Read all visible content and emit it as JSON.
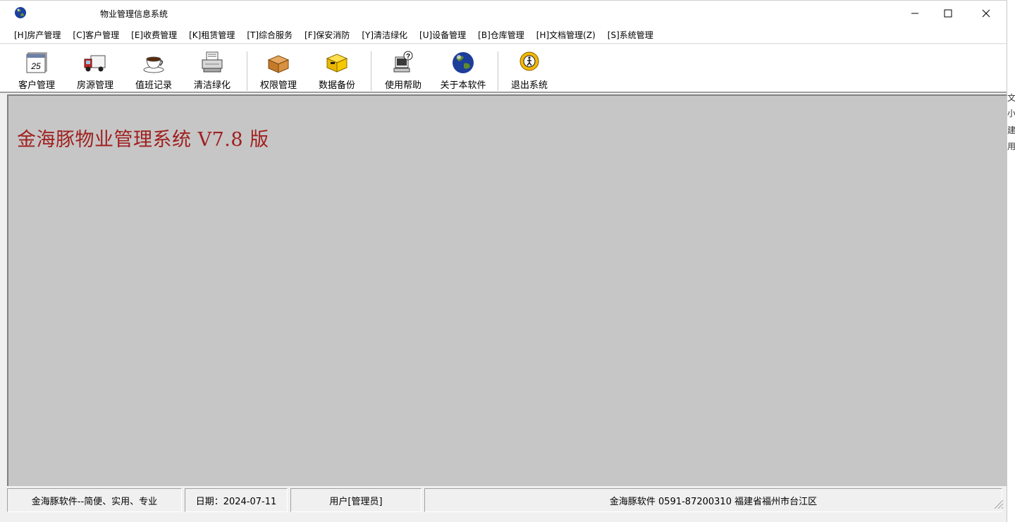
{
  "window": {
    "title": "物业管理信息系统",
    "controls": {
      "minimize": "—",
      "maximize": "☐",
      "close": "✕"
    }
  },
  "menu": [
    "[H]房产管理",
    "[C]客户管理",
    "[E]收费管理",
    "[K]租赁管理",
    "[T]综合服务",
    "[F]保安消防",
    "[Y]清洁绿化",
    "[U]设备管理",
    "[B]仓库管理",
    "[H]文档管理(Z)",
    "[S]系统管理"
  ],
  "toolbar": {
    "customer": {
      "label": "客户管理",
      "icon": "calendar-icon",
      "badge": "25"
    },
    "housing": {
      "label": "房源管理",
      "icon": "truck-icon"
    },
    "duty": {
      "label": "值班记录",
      "icon": "coffee-cup-icon"
    },
    "cleaning": {
      "label": "清洁绿化",
      "icon": "printer-icon"
    },
    "permission": {
      "label": "权限管理",
      "icon": "box-icon"
    },
    "backup": {
      "label": "数据备份",
      "icon": "yellow-box-icon"
    },
    "help": {
      "label": "使用帮助",
      "icon": "help-computer-icon"
    },
    "about": {
      "label": "关于本软件",
      "icon": "globe-icon"
    },
    "exit": {
      "label": "退出系统",
      "icon": "exit-person-icon"
    }
  },
  "main": {
    "title": "金海豚物业管理系统 V7.8 版",
    "background": "#c6c6c6",
    "title_color": "#a02020"
  },
  "status": {
    "slogan": "金海豚软件--简便、实用、专业",
    "date": "日期：2024-07-11",
    "user": "用户[管理员]",
    "contact": "金海豚软件  0591-87200310  福建省福州市台江区"
  },
  "peek_text": [
    "文",
    "小",
    "建",
    "用"
  ]
}
